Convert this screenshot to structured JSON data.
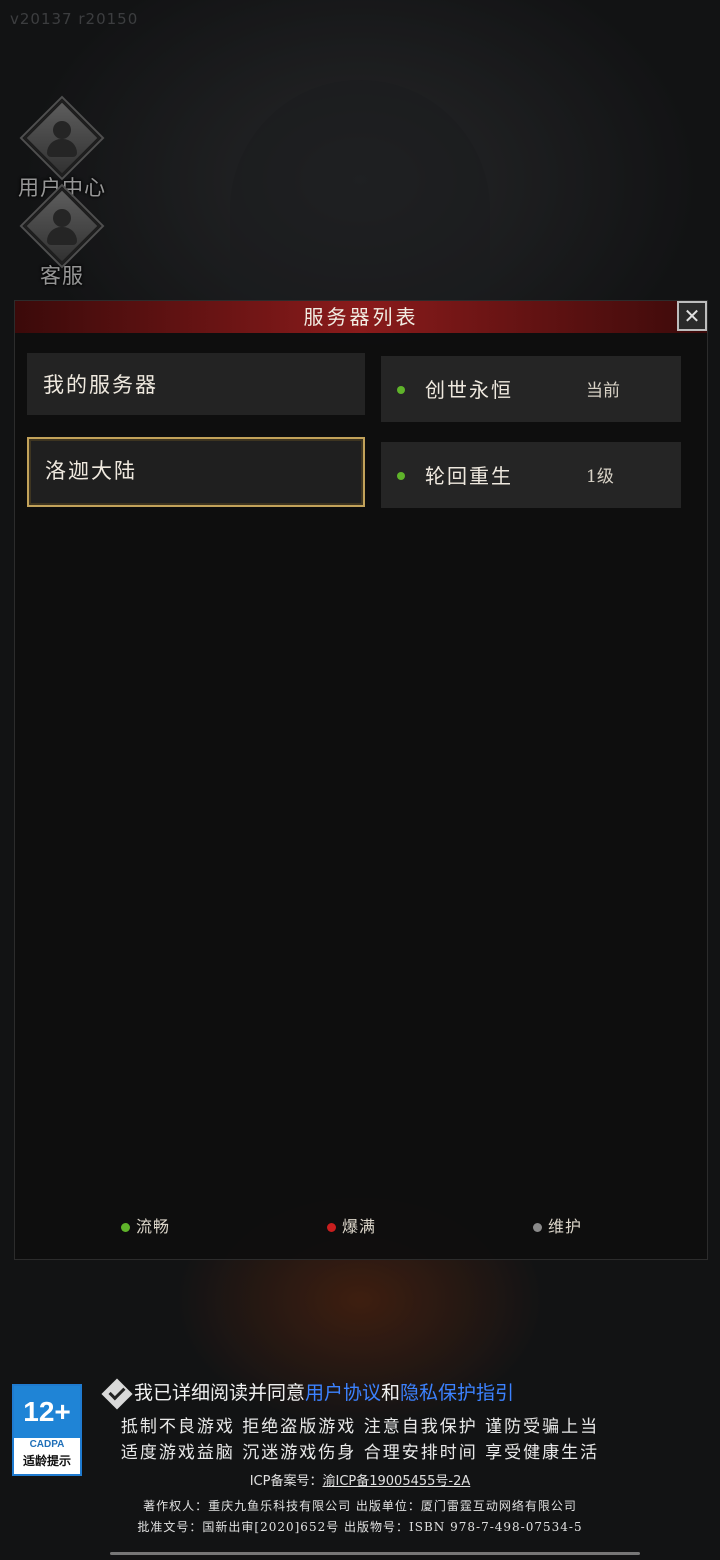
{
  "version": "v20137 r20150",
  "side_menu": [
    {
      "label": "用户中心",
      "icon": "user-center-icon"
    },
    {
      "label": "客服",
      "icon": "customer-service-icon"
    }
  ],
  "modal": {
    "title": "服务器列表",
    "close_icon": "close-icon",
    "categories": [
      {
        "label": "我的服务器",
        "selected": false
      },
      {
        "label": "洛迦大陆",
        "selected": true
      }
    ],
    "servers": [
      {
        "name": "创世永恒",
        "tag": "当前",
        "status_color": "#5fb32a"
      },
      {
        "name": "轮回重生",
        "tag": "1级",
        "status_color": "#5fb32a"
      }
    ],
    "legend": [
      {
        "label": "流畅",
        "color": "#5fb32a"
      },
      {
        "label": "爆满",
        "color": "#c81e1e"
      },
      {
        "label": "维护",
        "color": "#8a8a8a"
      }
    ]
  },
  "footer": {
    "age_badge": {
      "rating": "12+",
      "org": "CADPA",
      "text": "适龄提示"
    },
    "agreement": {
      "prefix": "我已详细阅读并同意",
      "link1": "用户协议",
      "and": "和",
      "link2": "隐私保护指引"
    },
    "notice_line1": "抵制不良游戏 拒绝盗版游戏 注意自我保护 谨防受骗上当",
    "notice_line2": "适度游戏益脑 沉迷游戏伤身 合理安排时间 享受健康生活",
    "icp_label": "ICP备案号：",
    "icp_value": "渝ICP备19005455号-2A",
    "copyright_line1": "著作权人：重庆九鱼乐科技有限公司 出版单位：厦门雷霆互动网络有限公司",
    "copyright_line2": "批准文号：国新出审[2020]652号 出版物号：ISBN 978-7-498-07534-5"
  }
}
